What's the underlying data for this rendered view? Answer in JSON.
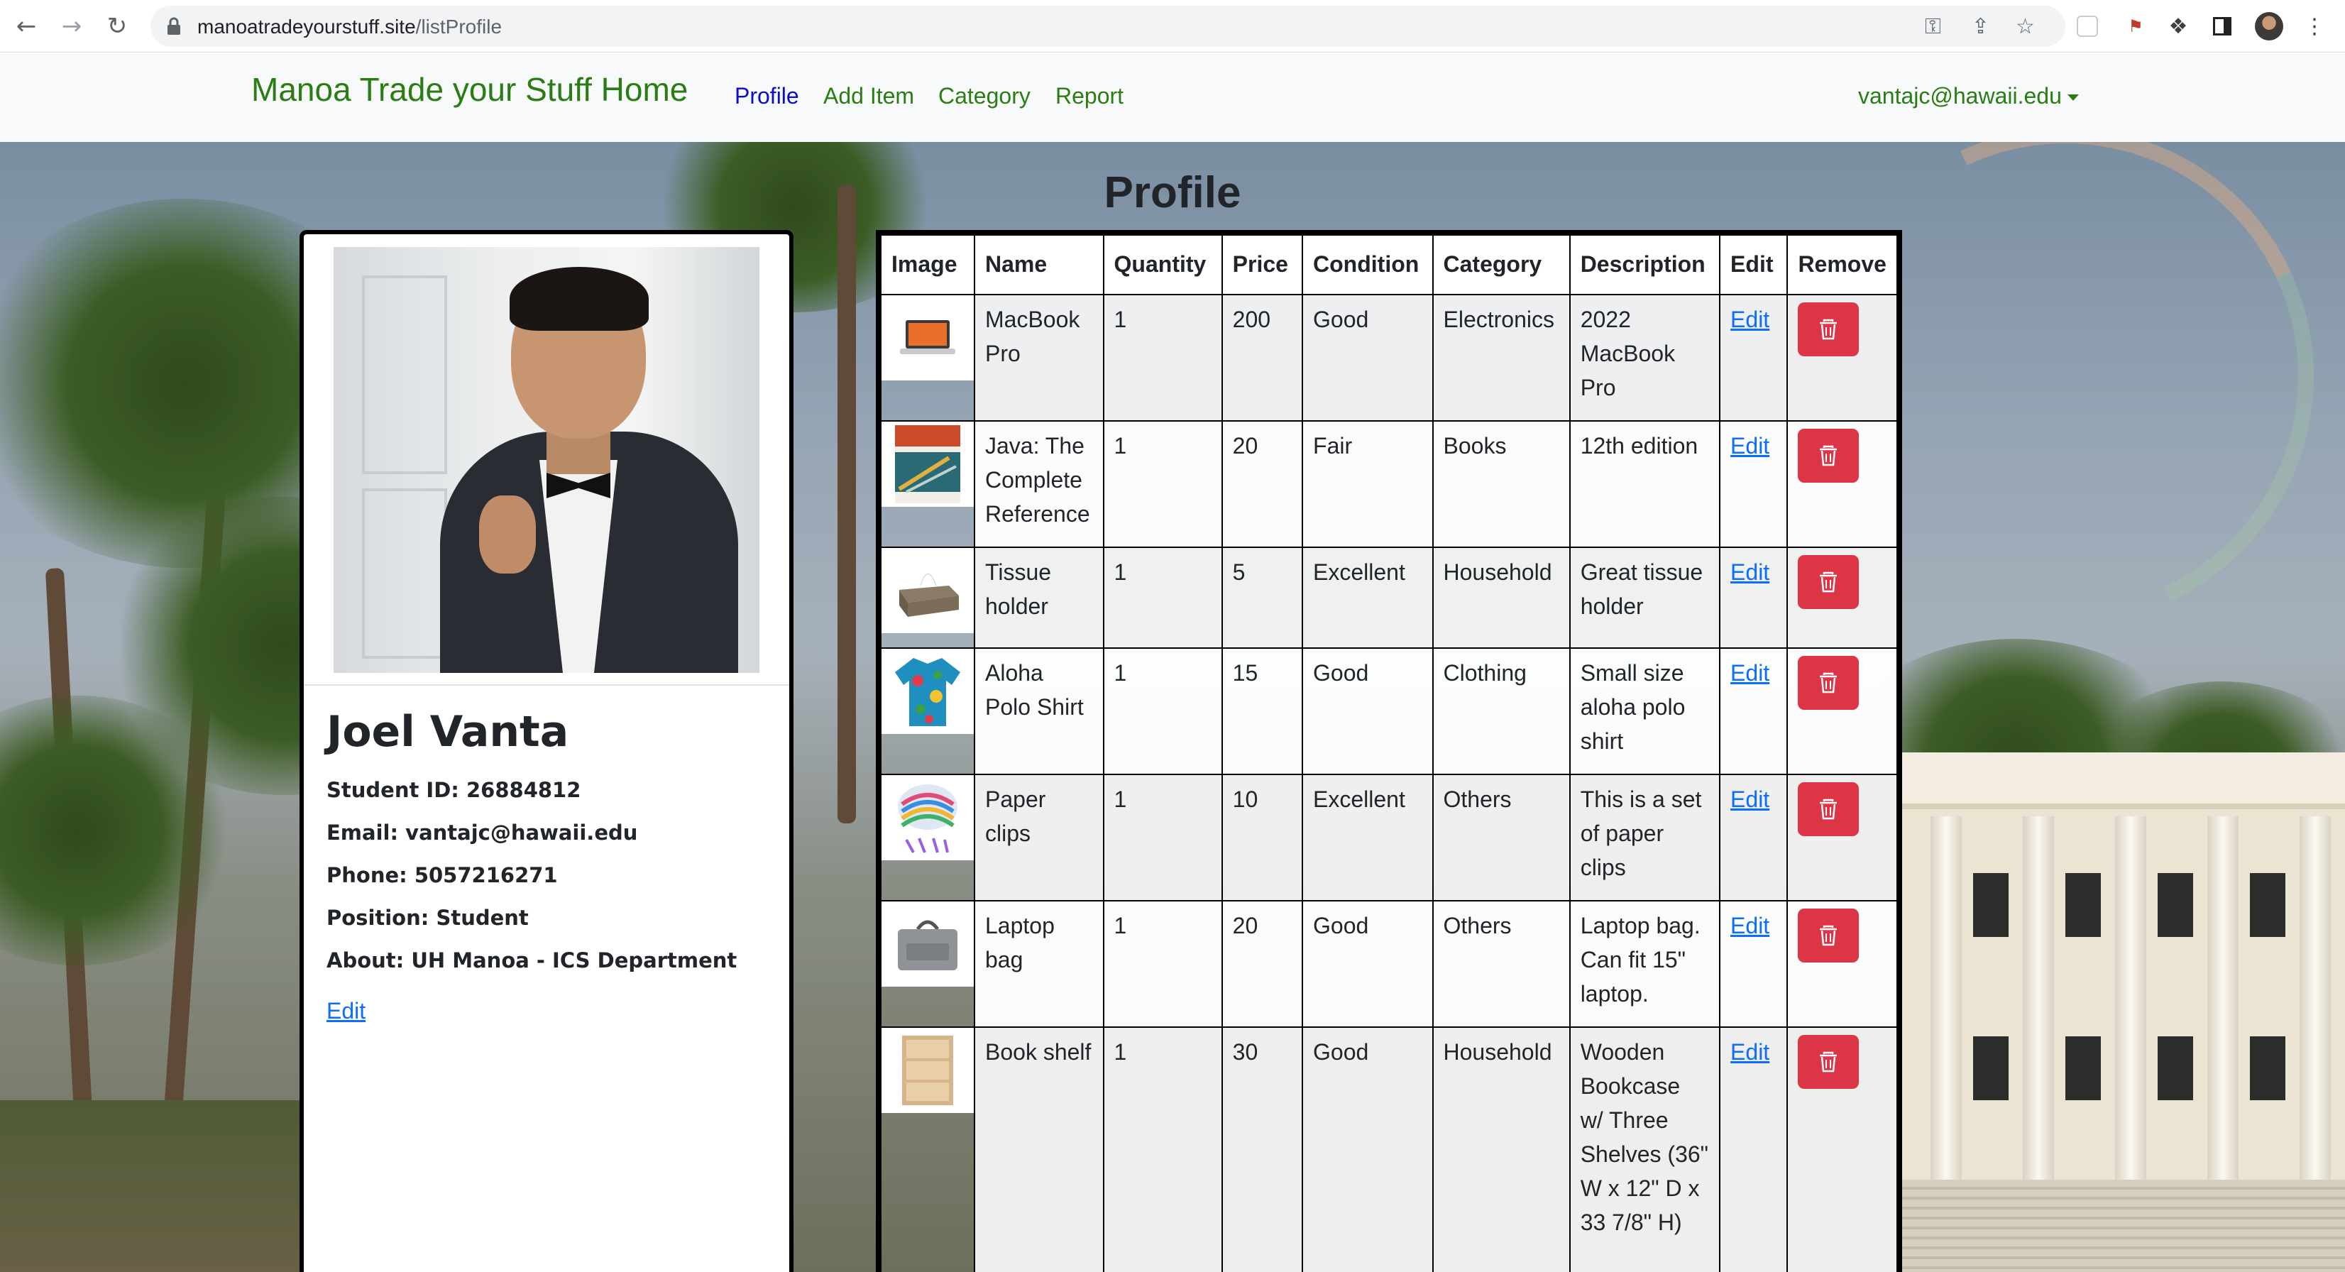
{
  "browser": {
    "url_host": "manoatradeyourstuff.site",
    "url_path": "/listProfile"
  },
  "navbar": {
    "brand": "Manoa Trade your Stuff Home",
    "links": [
      "Profile",
      "Add Item",
      "Category",
      "Report"
    ],
    "user": "vantajc@hawaii.edu"
  },
  "page": {
    "title": "Profile"
  },
  "profile": {
    "name": "Joel Vanta",
    "student_id": "Student ID: 26884812",
    "email": "Email: vantajc@hawaii.edu",
    "phone": "Phone: 5057216271",
    "position": "Position: Student",
    "about": "About: UH Manoa - ICS Department",
    "edit": "Edit"
  },
  "table": {
    "headers": [
      "Image",
      "Name",
      "Quantity",
      "Price",
      "Condition",
      "Category",
      "Description",
      "Edit",
      "Remove"
    ],
    "rows": [
      {
        "name": "MacBook Pro",
        "quantity": "1",
        "price": "200",
        "condition": "Good",
        "category": "Electronics",
        "description": "2022 MacBook Pro",
        "edit": "Edit",
        "image": "laptop-thumbnail"
      },
      {
        "name": "Java: The Complete Reference",
        "quantity": "1",
        "price": "20",
        "condition": "Fair",
        "category": "Books",
        "description": "12th edition",
        "edit": "Edit",
        "image": "book-cover-thumbnail"
      },
      {
        "name": "Tissue holder",
        "quantity": "1",
        "price": "5",
        "condition": "Excellent",
        "category": "Household",
        "description": "Great tissue holder",
        "edit": "Edit",
        "image": "tissue-box-thumbnail"
      },
      {
        "name": "Aloha Polo Shirt",
        "quantity": "1",
        "price": "15",
        "condition": "Good",
        "category": "Clothing",
        "description": "Small size aloha polo shirt",
        "edit": "Edit",
        "image": "aloha-shirt-thumbnail"
      },
      {
        "name": "Paper clips",
        "quantity": "1",
        "price": "10",
        "condition": "Excellent",
        "category": "Others",
        "description": "This is a set of paper clips",
        "edit": "Edit",
        "image": "paper-clips-thumbnail"
      },
      {
        "name": "Laptop bag",
        "quantity": "1",
        "price": "20",
        "condition": "Good",
        "category": "Others",
        "description": "Laptop bag. Can fit 15\" laptop.",
        "edit": "Edit",
        "image": "laptop-bag-thumbnail"
      },
      {
        "name": "Book shelf",
        "quantity": "1",
        "price": "30",
        "condition": "Good",
        "category": "Household",
        "description": "Wooden Bookcase w/ Three Shelves (36\" W x 12\" D x 33 7/8\" H)",
        "edit": "Edit",
        "image": "bookshelf-thumbnail"
      }
    ]
  },
  "colors": {
    "brand_green": "#2a7d12",
    "active_link": "#0d0dc8",
    "danger": "#dc3545",
    "link_blue": "#0d6efd"
  }
}
